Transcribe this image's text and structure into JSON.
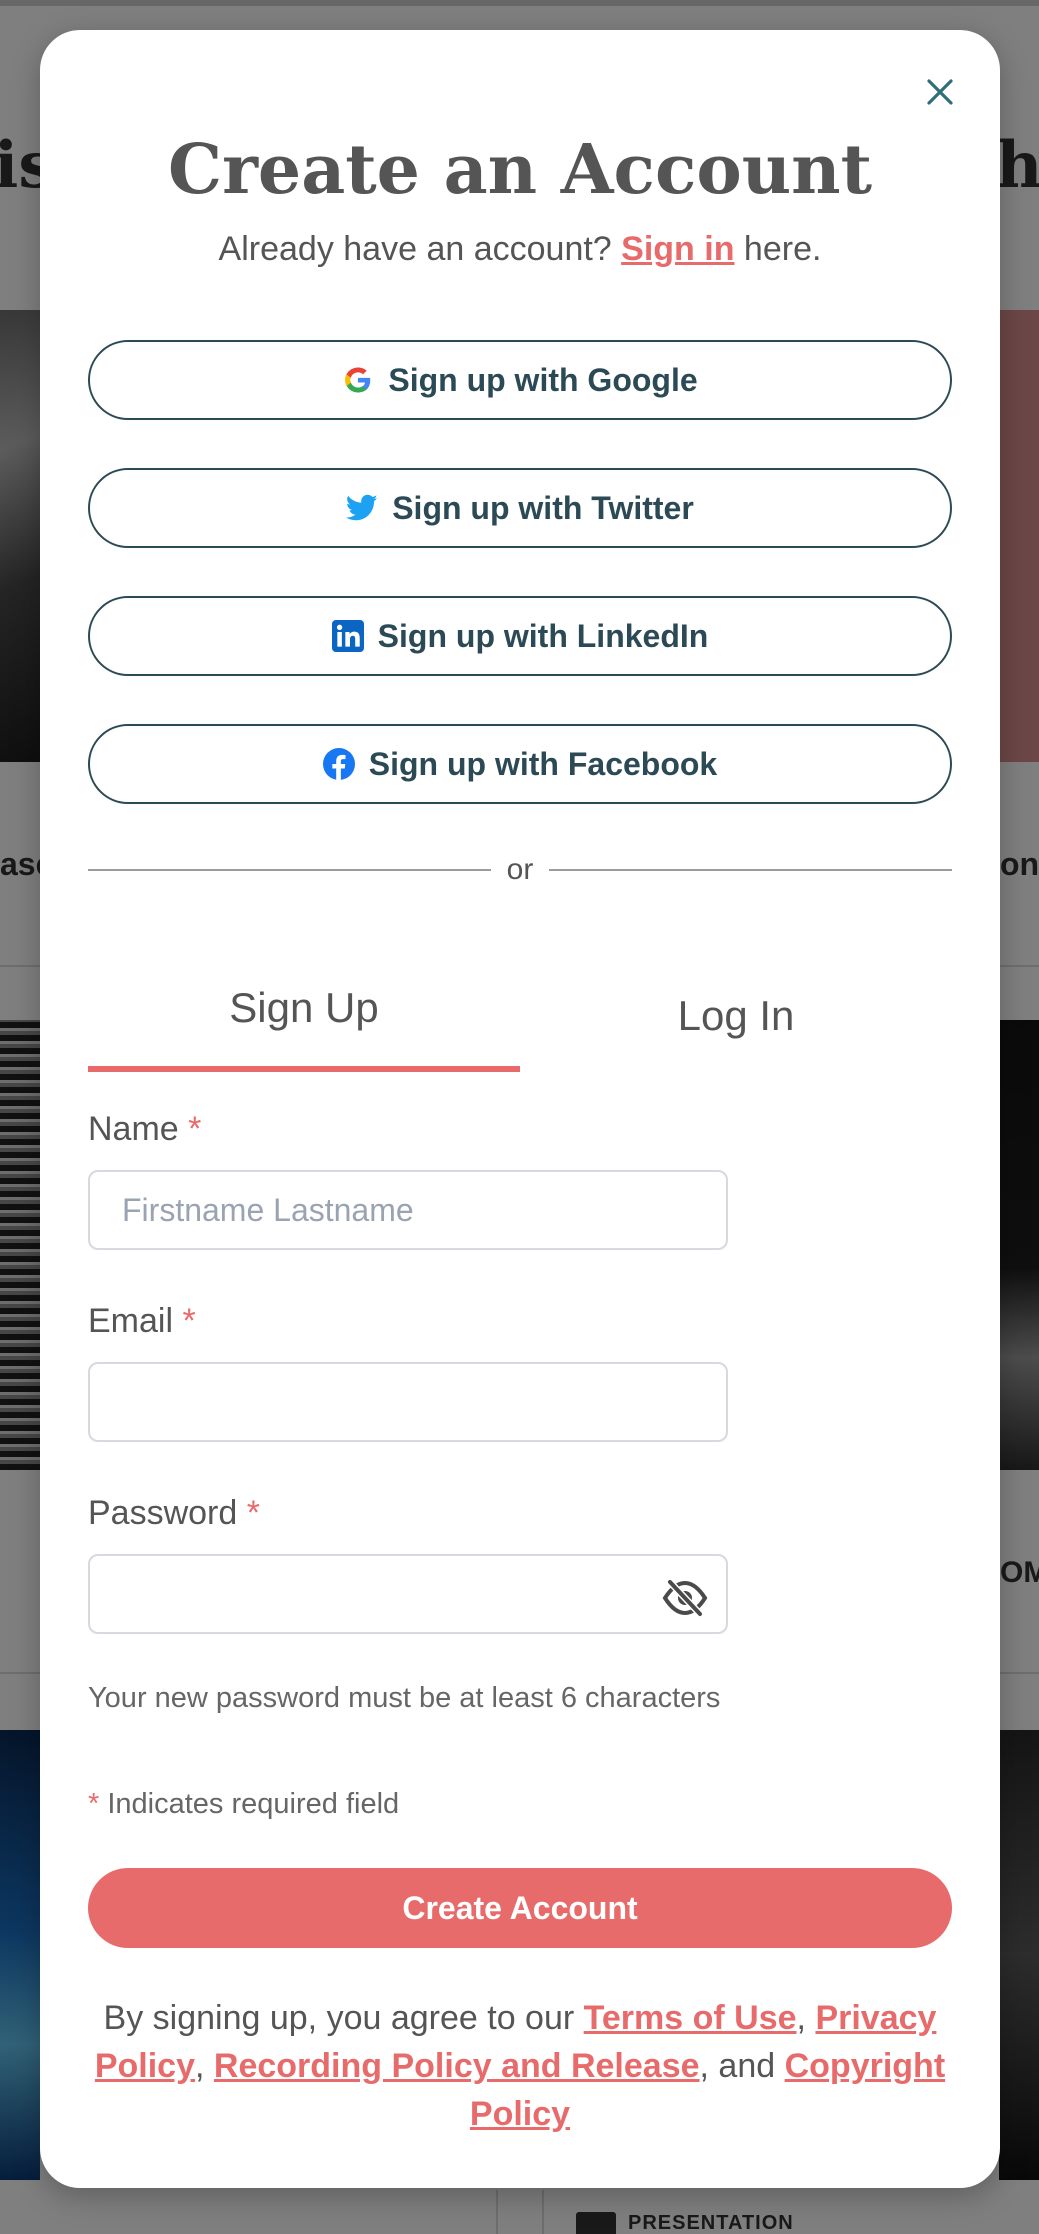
{
  "background": {
    "heading_left": "is",
    "heading_right": "he",
    "edge_text_left": "ase",
    "edge_text_right": "on",
    "card_label_right": "OM",
    "tag": "PRESENTATION"
  },
  "modal": {
    "close_icon": "close-icon",
    "title": "Create an Account",
    "subtitle": {
      "prefix": "Already have an account? ",
      "link": "Sign in",
      "suffix": " here."
    },
    "social": [
      {
        "label": "Sign up with Google",
        "icon": "google-icon"
      },
      {
        "label": "Sign up with Twitter",
        "icon": "twitter-icon"
      },
      {
        "label": "Sign up with LinkedIn",
        "icon": "linkedin-icon"
      },
      {
        "label": "Sign up with Facebook",
        "icon": "facebook-icon"
      }
    ],
    "divider_text": "or",
    "tabs": {
      "signup": "Sign Up",
      "login": "Log In",
      "active": "Sign Up"
    },
    "form": {
      "name_label": "Name",
      "name_placeholder": "Firstname Lastname",
      "name_value": "",
      "email_label": "Email",
      "email_value": "",
      "password_label": "Password",
      "password_value": "",
      "required_marker": "*",
      "password_hint": "Your new password must be at least 6 characters",
      "required_note": "Indicates required field",
      "submit_label": "Create Account"
    },
    "terms": {
      "prefix": "By signing up, you agree to our ",
      "terms_link": "Terms of Use",
      "sep1": ", ",
      "privacy_link": "Privacy Policy",
      "sep2": ", ",
      "recording_link": "Recording Policy and Release",
      "sep3": ", and ",
      "copyright_link": "Copyright Policy"
    }
  },
  "colors": {
    "accent": "#e86b6b",
    "button_border": "#2c4a55",
    "text": "#555555",
    "close": "#2f6f7a"
  }
}
